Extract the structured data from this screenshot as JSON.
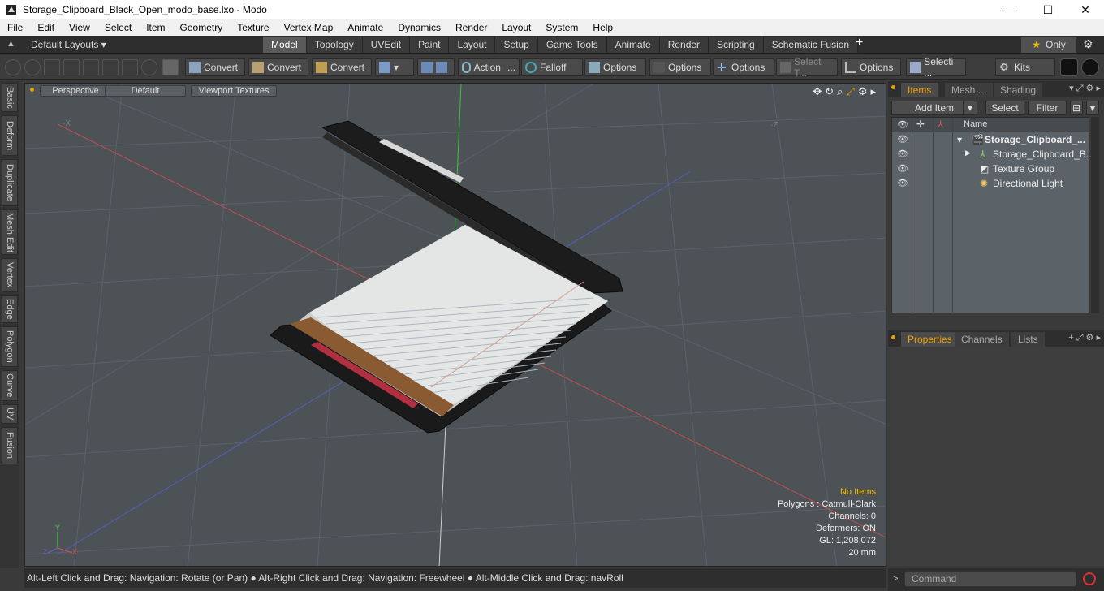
{
  "window": {
    "title": "Storage_Clipboard_Black_Open_modo_base.lxo - Modo",
    "minimize": "—",
    "maximize": "☐",
    "close": "✕"
  },
  "menu": [
    "File",
    "Edit",
    "View",
    "Select",
    "Item",
    "Geometry",
    "Texture",
    "Vertex Map",
    "Animate",
    "Dynamics",
    "Render",
    "Layout",
    "System",
    "Help"
  ],
  "layoutbar": {
    "layouts_label": "Default Layouts ▾",
    "tabs": [
      "Model",
      "Topology",
      "UVEdit",
      "Paint",
      "Layout",
      "Setup",
      "Game Tools",
      "Animate",
      "Render",
      "Scripting",
      "Schematic Fusion"
    ],
    "active_tab": "Model",
    "add": "+",
    "only_label": "Only"
  },
  "toolbar": {
    "convert1": "Convert",
    "convert2": "Convert",
    "convert3": "Convert",
    "action": "Action",
    "falloff": "Falloff",
    "options1": "Options",
    "options2": "Options",
    "options3": "Options",
    "select_t": "Select T...",
    "options4": "Options",
    "selecti": "Selecti ...",
    "kits": "Kits"
  },
  "left_tabs": [
    "Basic",
    "Deform",
    "Duplicate",
    "Mesh Edit",
    "Vertex",
    "Edge",
    "Polygon",
    "Curve",
    "UV",
    "Fusion"
  ],
  "viewport": {
    "view": "Perspective",
    "shading": "Default",
    "textures": "Viewport Textures",
    "info": {
      "no_items": "No Items",
      "polygons": "Polygons : Catmull-Clark",
      "channels": "Channels: 0",
      "deformers": "Deformers: ON",
      "gl": "GL: 1,208,072",
      "scale": "20 mm"
    },
    "axis_x": "-X",
    "axis_z": "-Z"
  },
  "items_panel": {
    "tabs": [
      "Items",
      "Mesh ...",
      "Shading"
    ],
    "add_item": "Add Item",
    "select": "Select",
    "filter": "Filter",
    "column_name": "Name",
    "rows": [
      {
        "label": "Storage_Clipboard_...",
        "bold": true
      },
      {
        "label": "Storage_Clipboard_B...",
        "bold": false
      },
      {
        "label": "Texture Group",
        "bold": false
      },
      {
        "label": "Directional Light",
        "bold": false
      }
    ]
  },
  "props_panel": {
    "tabs": [
      "Properties",
      "Channels",
      "Lists"
    ]
  },
  "status": {
    "hint": "Alt-Left Click and Drag: Navigation: Rotate (or Pan) ● Alt-Right Click and Drag: Navigation: Freewheel ● Alt-Middle Click and Drag: navRoll"
  },
  "command": {
    "placeholder": "Command"
  },
  "colors": {
    "accent": "#f0a000",
    "viewport_bg": "#4d5257"
  }
}
